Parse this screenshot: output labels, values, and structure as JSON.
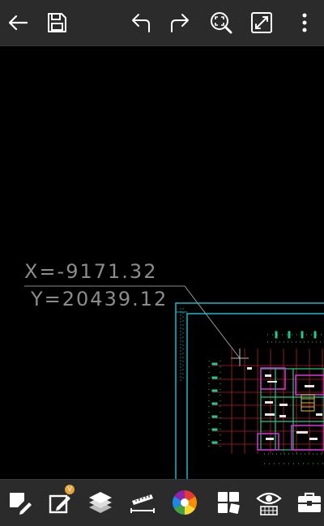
{
  "toolbar": {
    "icons": [
      "back-arrow-icon",
      "save-icon",
      "undo-icon",
      "redo-icon",
      "zoom-extents-icon",
      "fullscreen-icon",
      "more-vert-icon"
    ]
  },
  "canvas": {
    "background": "#000000",
    "coord_x": "X=-9171.32",
    "coord_y": "Y=20439.12",
    "drawing_colors": {
      "frame": "#18c6d8",
      "grid": "#c0262c",
      "walls": "#22c98a",
      "rooms": "#cc33cc",
      "text": "#ffffff",
      "highlight": "#d4c23a"
    }
  },
  "bottombar": {
    "icons": [
      "edit-tool-icon",
      "annotate-icon",
      "layers-icon",
      "measure-icon",
      "color-wheel-icon",
      "blocks-icon",
      "view-icon",
      "toolbox-icon"
    ],
    "annotate_badge": "V"
  }
}
